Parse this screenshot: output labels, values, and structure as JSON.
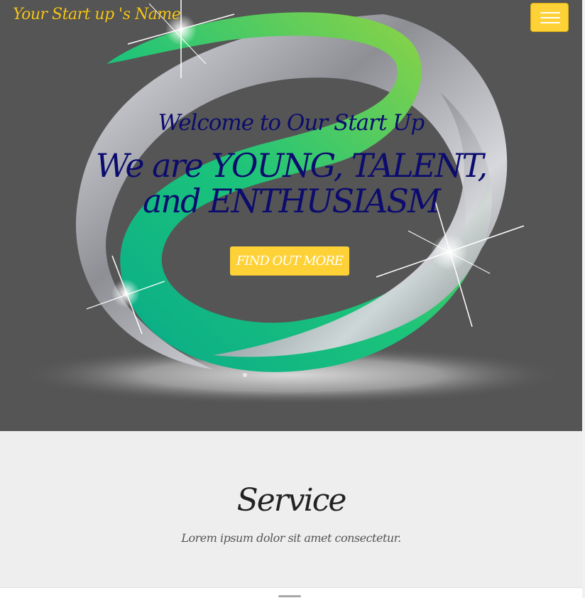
{
  "navbar": {
    "brand": "Your Start up 's Name",
    "menu_toggle_icon": "hamburger-icon"
  },
  "hero": {
    "lead": "Welcome to Our Start Up",
    "heading": "We are YOUNG, TALENT, and ENTHUSIASM",
    "cta_label": "FIND OUT MORE",
    "background_art": "swirl-logo-illustration"
  },
  "services": {
    "heading": "Service",
    "subheading": "Lorem ipsum dolor sit amet consectetur."
  },
  "colors": {
    "accent": "#fed136",
    "brand_text": "#f5c518",
    "heading_text": "#0c0c6e",
    "hero_background": "#555555",
    "section_background": "#eeeeee"
  }
}
